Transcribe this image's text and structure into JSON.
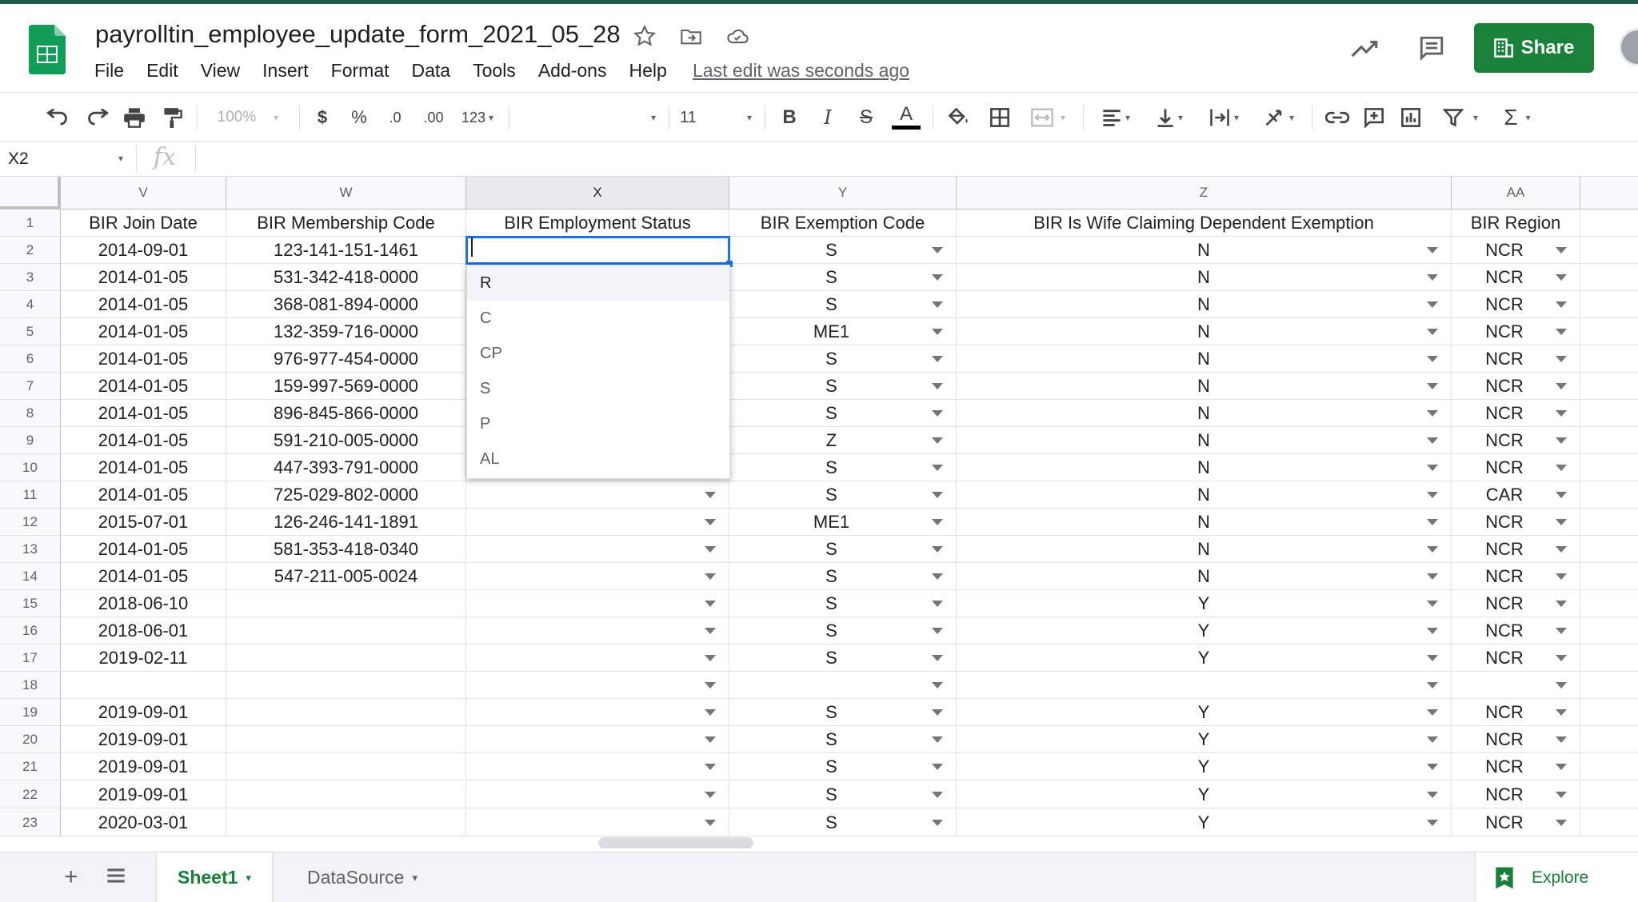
{
  "header": {
    "doc_title": "payrolltin_employee_update_form_2021_05_28",
    "menu": [
      "File",
      "Edit",
      "View",
      "Insert",
      "Format",
      "Data",
      "Tools",
      "Add-ons",
      "Help"
    ],
    "last_edit": "Last edit was seconds ago",
    "share_label": "Share"
  },
  "toolbar": {
    "zoom": "100%",
    "currency": "$",
    "percent": "%",
    "decimal_decrease": ".0",
    "decimal_increase": ".00",
    "more_formats": "123",
    "font_size": "11",
    "bold": "B",
    "italic": "I",
    "strike": "S",
    "text_color": "A",
    "sum": "Σ"
  },
  "formula_bar": {
    "cell_ref": "X2",
    "fx": "fx"
  },
  "grid": {
    "columns": [
      "V",
      "W",
      "X",
      "Y",
      "Z",
      "AA"
    ],
    "rows": [
      "1",
      "2",
      "3",
      "4",
      "5",
      "6",
      "7",
      "8",
      "9",
      "10",
      "11",
      "12",
      "13",
      "14",
      "15",
      "16",
      "17",
      "18",
      "19",
      "20",
      "21",
      "22",
      "23"
    ],
    "headers": [
      "BIR Join Date",
      "BIR Membership Code",
      "BIR Employment Status",
      "BIR Exemption Code",
      "BIR Is Wife Claiming Dependent Exemption",
      "BIR Region"
    ],
    "data": [
      [
        "2014-09-01",
        "123-141-151-1461",
        "",
        "S",
        "N",
        "NCR"
      ],
      [
        "2014-01-05",
        "531-342-418-0000",
        "",
        "S",
        "N",
        "NCR"
      ],
      [
        "2014-01-05",
        "368-081-894-0000",
        "",
        "S",
        "N",
        "NCR"
      ],
      [
        "2014-01-05",
        "132-359-716-0000",
        "",
        "ME1",
        "N",
        "NCR"
      ],
      [
        "2014-01-05",
        "976-977-454-0000",
        "",
        "S",
        "N",
        "NCR"
      ],
      [
        "2014-01-05",
        "159-997-569-0000",
        "",
        "S",
        "N",
        "NCR"
      ],
      [
        "2014-01-05",
        "896-845-866-0000",
        "",
        "S",
        "N",
        "NCR"
      ],
      [
        "2014-01-05",
        "591-210-005-0000",
        "",
        "Z",
        "N",
        "NCR"
      ],
      [
        "2014-01-05",
        "447-393-791-0000",
        "",
        "S",
        "N",
        "NCR"
      ],
      [
        "2014-01-05",
        "725-029-802-0000",
        "",
        "S",
        "N",
        "CAR"
      ],
      [
        "2015-07-01",
        "126-246-141-1891",
        "",
        "ME1",
        "N",
        "NCR"
      ],
      [
        "2014-01-05",
        "581-353-418-0340",
        "",
        "S",
        "N",
        "NCR"
      ],
      [
        "2014-01-05",
        "547-211-005-0024",
        "",
        "S",
        "N",
        "NCR"
      ],
      [
        "2018-06-10",
        "",
        "",
        "S",
        "Y",
        "NCR"
      ],
      [
        "2018-06-01",
        "",
        "",
        "S",
        "Y",
        "NCR"
      ],
      [
        "2019-02-11",
        "",
        "",
        "S",
        "Y",
        "NCR"
      ],
      [
        "",
        "",
        "",
        "",
        "",
        ""
      ],
      [
        "2019-09-01",
        "",
        "",
        "S",
        "Y",
        "NCR"
      ],
      [
        "2019-09-01",
        "",
        "",
        "S",
        "Y",
        "NCR"
      ],
      [
        "2019-09-01",
        "",
        "",
        "S",
        "Y",
        "NCR"
      ],
      [
        "2019-09-01",
        "",
        "",
        "S",
        "Y",
        "NCR"
      ],
      [
        "2020-03-01",
        "",
        "",
        "S",
        "Y",
        "NCR"
      ]
    ]
  },
  "dropdown": {
    "options": [
      "R",
      "C",
      "CP",
      "S",
      "P",
      "AL"
    ]
  },
  "sheets": {
    "tabs": [
      "Sheet1",
      "DataSource"
    ],
    "explore_label": "Explore"
  }
}
